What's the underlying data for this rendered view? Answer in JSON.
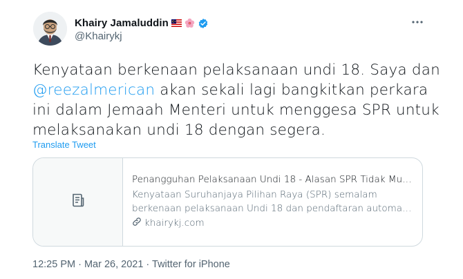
{
  "author": {
    "name": "Khairy Jamaluddin",
    "handle": "@Khairykj",
    "flags": [
      "malaysia-flag-icon",
      "hibiscus-icon",
      "verified-badge-icon"
    ]
  },
  "tweet": {
    "text_before": "Kenyataan berkenaan pelaksanaan undi 18. Saya dan",
    "mention": "@reezalmerican",
    "text_after": "akan sekali lagi bangkitkan perkara ini dalam Jemaah Menteri untuk menggesa SPR untuk melaksanakan undi 18 dengan segera.",
    "translate_label": "Translate Tweet"
  },
  "link_card": {
    "title": "Penangguhan Pelaksanaan Undi 18 - Alasan SPR Tidak Mun...",
    "description_line1": "Kenyataan Suruhanjaya Pilihan Raya (SPR) semalam",
    "description_line2": "berkenaan pelaksanaan Undi 18 dan pendaftaran automatik...",
    "domain": "khairykj.com"
  },
  "meta": {
    "timestamp": "12:25 PM · Mar 26, 2021 · Twitter for iPhone"
  },
  "colors": {
    "link": "#1d9bf0",
    "secondary_text": "#536471",
    "border": "#cfd9de"
  }
}
